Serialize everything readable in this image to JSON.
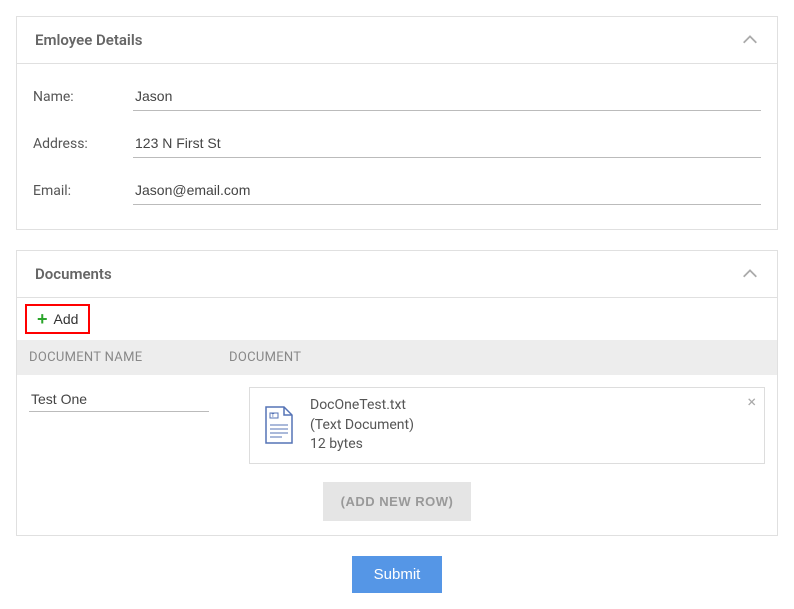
{
  "employee_panel": {
    "title": "Emloyee Details",
    "fields": {
      "name_label": "Name:",
      "name_value": "Jason",
      "address_label": "Address:",
      "address_value": "123 N First St",
      "email_label": "Email:",
      "email_value": "Jason@email.com"
    }
  },
  "documents_panel": {
    "title": "Documents",
    "add_label": "Add",
    "columns": {
      "doc_name": "DOCUMENT NAME",
      "document": "DOCUMENT"
    },
    "rows": [
      {
        "doc_name": "Test One",
        "file": {
          "name": "DocOneTest.txt",
          "type": "(Text Document)",
          "size": "12 bytes"
        }
      }
    ],
    "placeholder": "(ADD NEW ROW)"
  },
  "submit_label": "Submit"
}
